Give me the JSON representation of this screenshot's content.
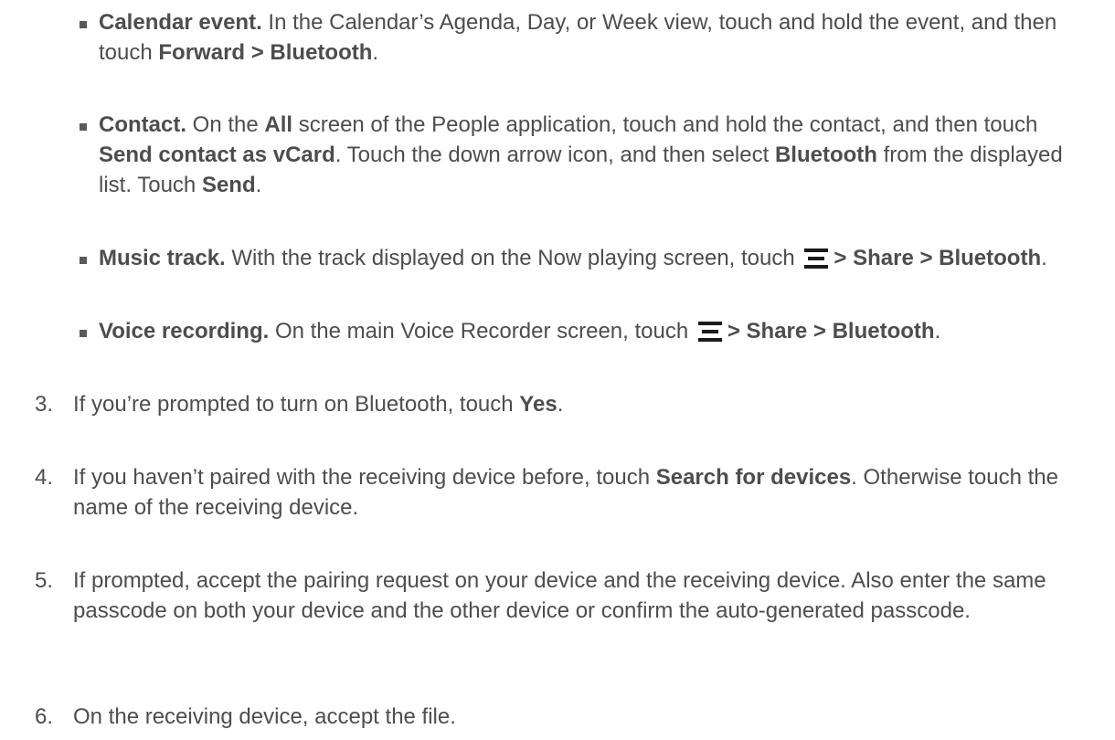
{
  "bullets": [
    {
      "lead": "Calendar event.",
      "text1": " In the Calendar’s Agenda, Day, or Week view, touch and hold the event, and then touch ",
      "b1": "Forward > Bluetooth",
      "text2": "."
    },
    {
      "lead": "Contact.",
      "text1": " On the ",
      "b1": "All",
      "text2": " screen of the People application, touch and hold the contact, and then touch ",
      "b2": "Send contact as vCard",
      "text3": ". Touch the down arrow icon, and then select ",
      "b3": "Bluetooth",
      "text4": " from the displayed list. Touch ",
      "b4": "Send",
      "text5": "."
    },
    {
      "lead": "Music track.",
      "text1": " With the track displayed on the Now playing screen, touch ",
      "icon": "menu-icon",
      "b1": "> Share > Bluetooth",
      "text2": "."
    },
    {
      "lead": "Voice recording.",
      "text1": " On the main Voice Recorder screen, touch ",
      "icon": "menu-icon",
      "b1": "> Share > Bluetooth",
      "text2": "."
    }
  ],
  "steps": [
    {
      "num": "3.",
      "text1": "If you’re prompted to turn on Bluetooth, touch ",
      "b1": "Yes",
      "text2": "."
    },
    {
      "num": "4.",
      "text1": "If you haven’t paired with the receiving device before, touch ",
      "b1": "Search for devices",
      "text2": ". Otherwise touch the name of the receiving device."
    },
    {
      "num": "5.",
      "text1": "If prompted, accept the pairing request on your device and the receiving device. Also enter the same passcode on both your device and the other device or confirm the auto-generated passcode."
    },
    {
      "num": "6.",
      "text1": "On the receiving device, accept the file."
    }
  ],
  "colors": {
    "text": "#4d4d4f",
    "bullet": "#5a5a5c",
    "icon": "#1a1a1a"
  }
}
